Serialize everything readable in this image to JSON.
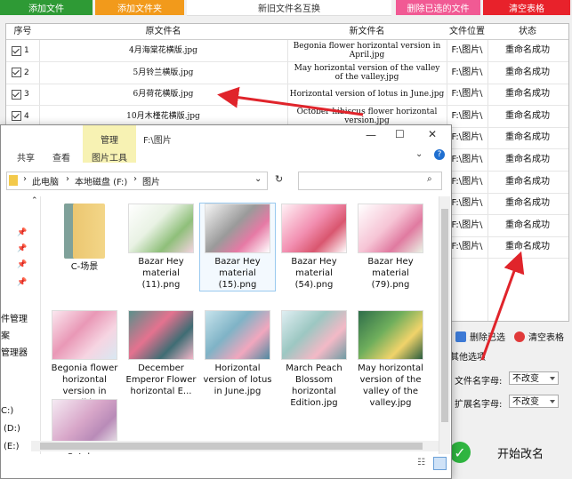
{
  "top_buttons": {
    "add_file": "添加文件",
    "add_folder": "添加文件夹",
    "new_name_replace": "新旧文件名互换",
    "delete_selected": "删除已选的文件",
    "clear_table": "清空表格"
  },
  "table": {
    "headers": [
      "序号",
      "原文件名",
      "新文件名",
      "文件位置",
      "状态"
    ],
    "rows": [
      {
        "no": "1",
        "original": "4月海棠花横版.jpg",
        "new": "Begonia flower horizontal version in April.jpg",
        "location": "F:\\图片\\",
        "status": "重命名成功"
      },
      {
        "no": "2",
        "original": "5月铃兰横版.jpg",
        "new": "May horizontal version of the valley of the valley.jpg",
        "location": "F:\\图片\\",
        "status": "重命名成功"
      },
      {
        "no": "3",
        "original": "6月荷花横版.jpg",
        "new": "Horizontal version of lotus in June.jpg",
        "location": "F:\\图片\\",
        "status": "重命名成功"
      },
      {
        "no": "4",
        "original": "10月木槿花横版.jpg",
        "new": "October hibiscus flower horizontal version.jpg",
        "location": "F:\\图片\\",
        "status": "重命名成功"
      },
      {
        "no": "",
        "original": "",
        "new": "",
        "location": "F:\\图片\\",
        "status": "重命名成功"
      },
      {
        "no": "",
        "original": "",
        "new": "",
        "location": "F:\\图片\\",
        "status": "重命名成功"
      },
      {
        "no": "",
        "original": "",
        "new": "",
        "location": "F:\\图片\\",
        "status": "重命名成功"
      },
      {
        "no": "",
        "original": "",
        "new": "",
        "location": "F:\\图片\\",
        "status": "重命名成功"
      },
      {
        "no": "",
        "original": "",
        "new": "",
        "location": "F:\\图片\\",
        "status": "重命名成功"
      },
      {
        "no": "",
        "original": "",
        "new": "",
        "location": "F:\\图片\\",
        "status": "重命名成功"
      }
    ]
  },
  "right_panel": {
    "delete_selected": "删除已选",
    "clear_table": "清空表格",
    "other_options": "其他选项",
    "filename_case_label": "文件名字母:",
    "filename_case_value": "不改变",
    "ext_case_label": "扩展名字母:",
    "ext_case_value": "不改变",
    "start_rename": "开始改名"
  },
  "explorer": {
    "tab_share": "共享",
    "tab_view": "查看",
    "tab_manage": "管理",
    "tab_picture_tools": "图片工具",
    "title": "F:\\图片",
    "crumbs": [
      "此电脑",
      "本地磁盘 (F:)",
      "图片"
    ],
    "nav": [
      "件管理",
      "案",
      "管理器",
      "C:)",
      "(D:)",
      "(E:)"
    ],
    "items": [
      {
        "name": "C-场景",
        "kind": "folder"
      },
      {
        "name": "Bazar Hey material (11).png",
        "kind": "image"
      },
      {
        "name": "Bazar Hey material (15).png",
        "kind": "image"
      },
      {
        "name": "Bazar Hey material (54).png",
        "kind": "image"
      },
      {
        "name": "Bazar Hey material (79).png",
        "kind": "image"
      },
      {
        "name": "Begonia flower horizontal version in April.jpg",
        "kind": "image"
      },
      {
        "name": "December Emperor Flower horizontal E...",
        "kind": "image"
      },
      {
        "name": "Horizontal version of lotus in June.jpg",
        "kind": "image"
      },
      {
        "name": "March Peach Blossom horizontal Edition.jpg",
        "kind": "image"
      },
      {
        "name": "May horizontal version of the valley of the valley.jpg",
        "kind": "image"
      },
      {
        "name": "October",
        "kind": "image"
      }
    ]
  },
  "colors": {
    "green": "#2e9a35",
    "orange": "#f29a1b",
    "pink": "#f15a94",
    "red": "#e8222b",
    "arrow": "#e0242b"
  }
}
